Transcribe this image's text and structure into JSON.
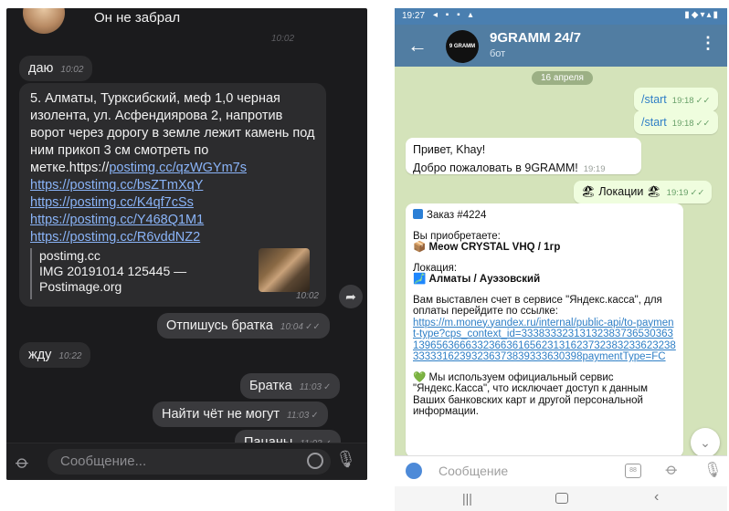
{
  "left": {
    "header_message": "Он не забрал",
    "header_time": "10:02",
    "messages": [
      {
        "text": "даю",
        "time": "10:02"
      },
      {
        "body": "5. Алматы, Турксибский, меф 1,0 черная изолента, ул. Асфендиярова 2, напротив ворот через дорогу в земле лежит камень под ним прикоп 3 см смотреть по метке.https://",
        "links": [
          "postimg.cc/qzWGYm7s",
          "https://postimg.cc/bsZTmXqY",
          "https://postimg.cc/K4qf7cSs",
          "https://postimg.cc/Y468Q1M1",
          "https://postimg.cc/R6vddNZ2"
        ],
        "preview_site": "postimg.cc",
        "preview_title": "IMG 20191014 125445 — Postimage.org",
        "time": "10:02"
      },
      {
        "text": "Отпишусь братка",
        "time": "10:04"
      },
      {
        "text": "жду",
        "time": "10:22"
      },
      {
        "text": "Братка",
        "time": "11:03"
      },
      {
        "text": "Найти чёт не могут",
        "time": "11:03"
      },
      {
        "text": "Пацаны",
        "time": "11:03"
      }
    ],
    "input_placeholder": "Сообщение..."
  },
  "right": {
    "status_time": "19:27",
    "chat_title": "9GRAMM 24/7",
    "chat_subtitle": "бот",
    "avatar_text": "9 GRAMM",
    "date_badge": "16 апреля",
    "out1": {
      "text": "/start",
      "time": "19:18"
    },
    "out2": {
      "text": "/start",
      "time": "19:18"
    },
    "in1": {
      "line1": "Привет, Khay!",
      "line2": "Добро пожаловать в 9GRAMM!",
      "time": "19:19"
    },
    "out3": {
      "text": "🏖 Локации 🏖",
      "time": "19:19"
    },
    "order": {
      "title": "Заказ #4224",
      "buy_label": "Вы приобретаете:",
      "product": "Meow CRYSTAL VHQ / 1гр",
      "loc_label": "Локация:",
      "location": "Алматы / Ауэзовский",
      "invoice_text": "Вам выставлен счет в сервисе \"Яндекс.касса\", для оплаты перейдите по ссылке:",
      "link": "https://m.money.yandex.ru/internal/public-api/to-payment-type?cps_context_id=3338333231313238373653036313965636663323663616562313162373238323362323833333162393236373839333630398paymentType=FC",
      "note": "Мы используем официальный сервис \"Яндекс.Касса\", что исключает доступ к данным Ваших банковских карт и другой персональной информации."
    },
    "input_placeholder": "Сообщение"
  },
  "colors": {
    "telegram_header": "#517da2",
    "telegram_bg": "#d4e3ba",
    "outgoing_bubble": "#effdde",
    "dark_bg": "#1b1b1d"
  }
}
